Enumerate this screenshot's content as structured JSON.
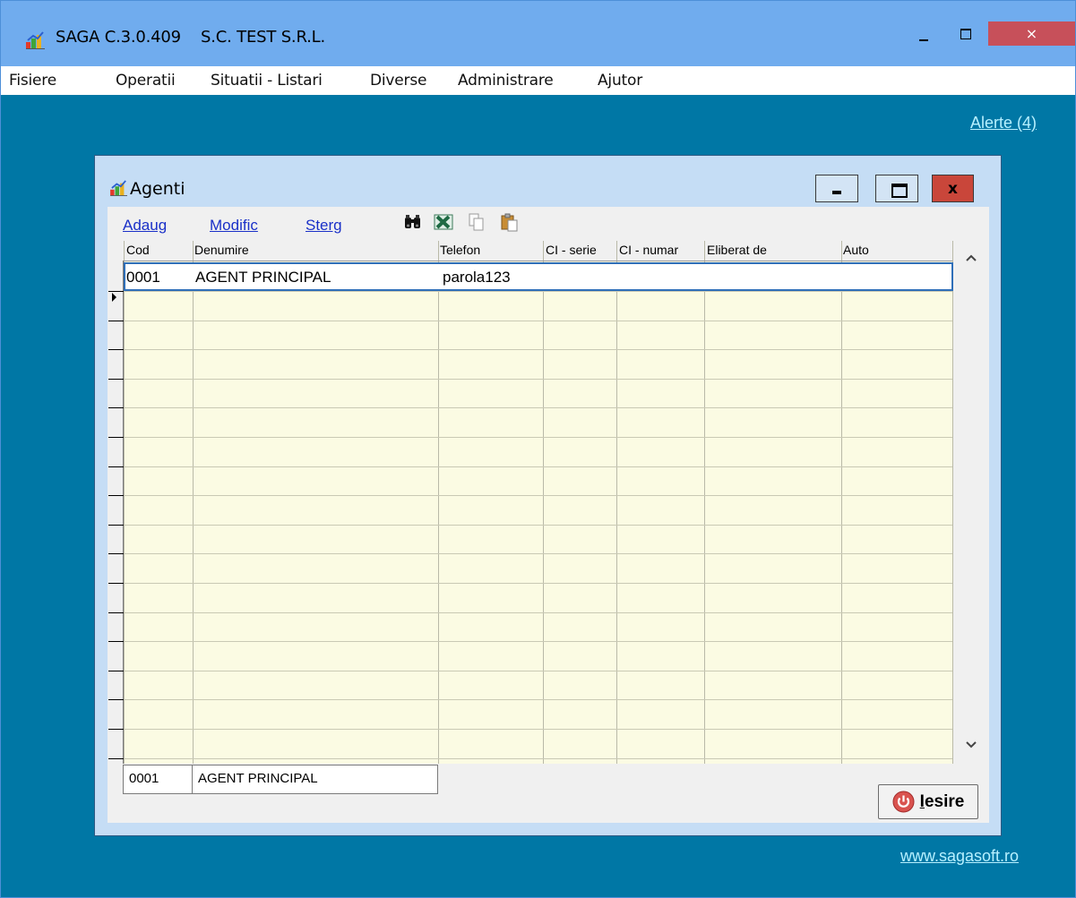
{
  "app": {
    "title": "SAGA C.3.0.409    S.C. TEST S.R.L.",
    "close_glyph": "×"
  },
  "menu": [
    "Fisiere",
    "Operatii",
    "Situatii - Listari",
    "Diverse",
    "Administrare",
    "Ajutor"
  ],
  "workspace": {
    "alerts_link": "Alerte (4)",
    "website_link": "www.sagasoft.ro"
  },
  "child_window": {
    "title": "Agenti",
    "close_glyph": "x"
  },
  "toolbar": {
    "add_label": "Adaug",
    "edit_label": "Modific",
    "delete_label": "Sterg",
    "icons": [
      "binoculars-icon",
      "excel-export-icon",
      "copy-icon",
      "paste-icon"
    ]
  },
  "grid": {
    "columns": [
      "Cod",
      "Denumire",
      "Telefon",
      "CI - serie",
      "CI - numar",
      "Eliberat de",
      "Auto"
    ],
    "rows": [
      {
        "cod": "0001",
        "denumire": "AGENT PRINCIPAL",
        "telefon": "parola123",
        "ci_serie": "",
        "ci_numar": "",
        "eliberat_de": "",
        "auto": ""
      }
    ]
  },
  "footer": {
    "cod": "0001",
    "denumire": "AGENT PRINCIPAL"
  },
  "exit_button": {
    "underlined_char": "I",
    "label_rest": "esire"
  },
  "colors": {
    "titlebar": "#70acee",
    "workspace": "#0077a5",
    "grid_background": "#fbfbe3",
    "link": "#1a30c8",
    "close_button": "#c9463a"
  }
}
